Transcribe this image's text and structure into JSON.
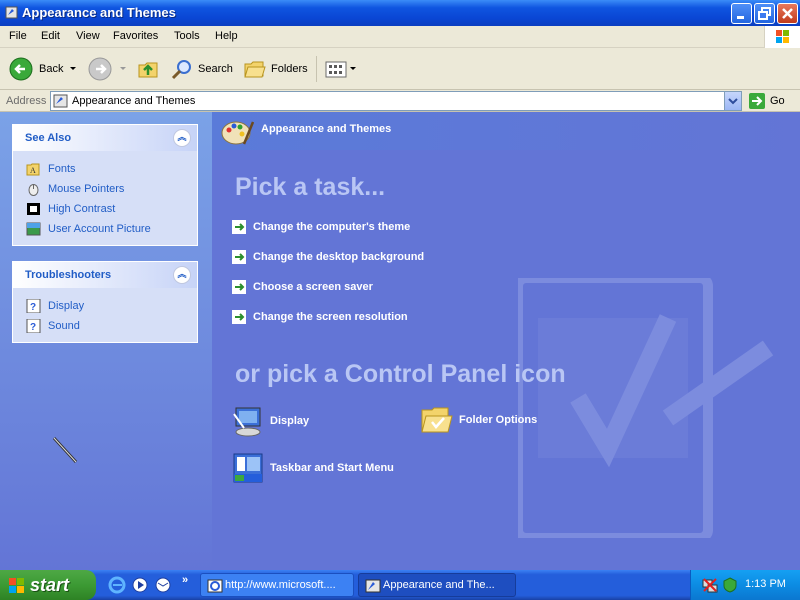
{
  "window": {
    "title": "Appearance and Themes"
  },
  "menu": {
    "items": [
      "File",
      "Edit",
      "View",
      "Favorites",
      "Tools",
      "Help"
    ]
  },
  "toolbar": {
    "back": "Back",
    "search": "Search",
    "folders": "Folders"
  },
  "address": {
    "label": "Address",
    "value": "Appearance and Themes",
    "go": "Go"
  },
  "see_also": {
    "title": "See Also",
    "items": [
      "Fonts",
      "Mouse Pointers",
      "High Contrast",
      "User Account Picture"
    ]
  },
  "troubleshooters": {
    "title": "Troubleshooters",
    "items": [
      "Display",
      "Sound"
    ]
  },
  "main": {
    "header": "Appearance and Themes",
    "pick_task": "Pick a task...",
    "tasks": [
      "Change the computer's theme",
      "Change the desktop background",
      "Choose a screen saver",
      "Change the screen resolution"
    ],
    "or_pick": "or pick a Control Panel icon",
    "icons": [
      "Display",
      "Folder Options",
      "Taskbar and Start Menu"
    ]
  },
  "taskbar": {
    "start": "start",
    "tasks": [
      "http://www.microsoft....",
      "Appearance and The..."
    ],
    "clock": "1:13 PM"
  }
}
